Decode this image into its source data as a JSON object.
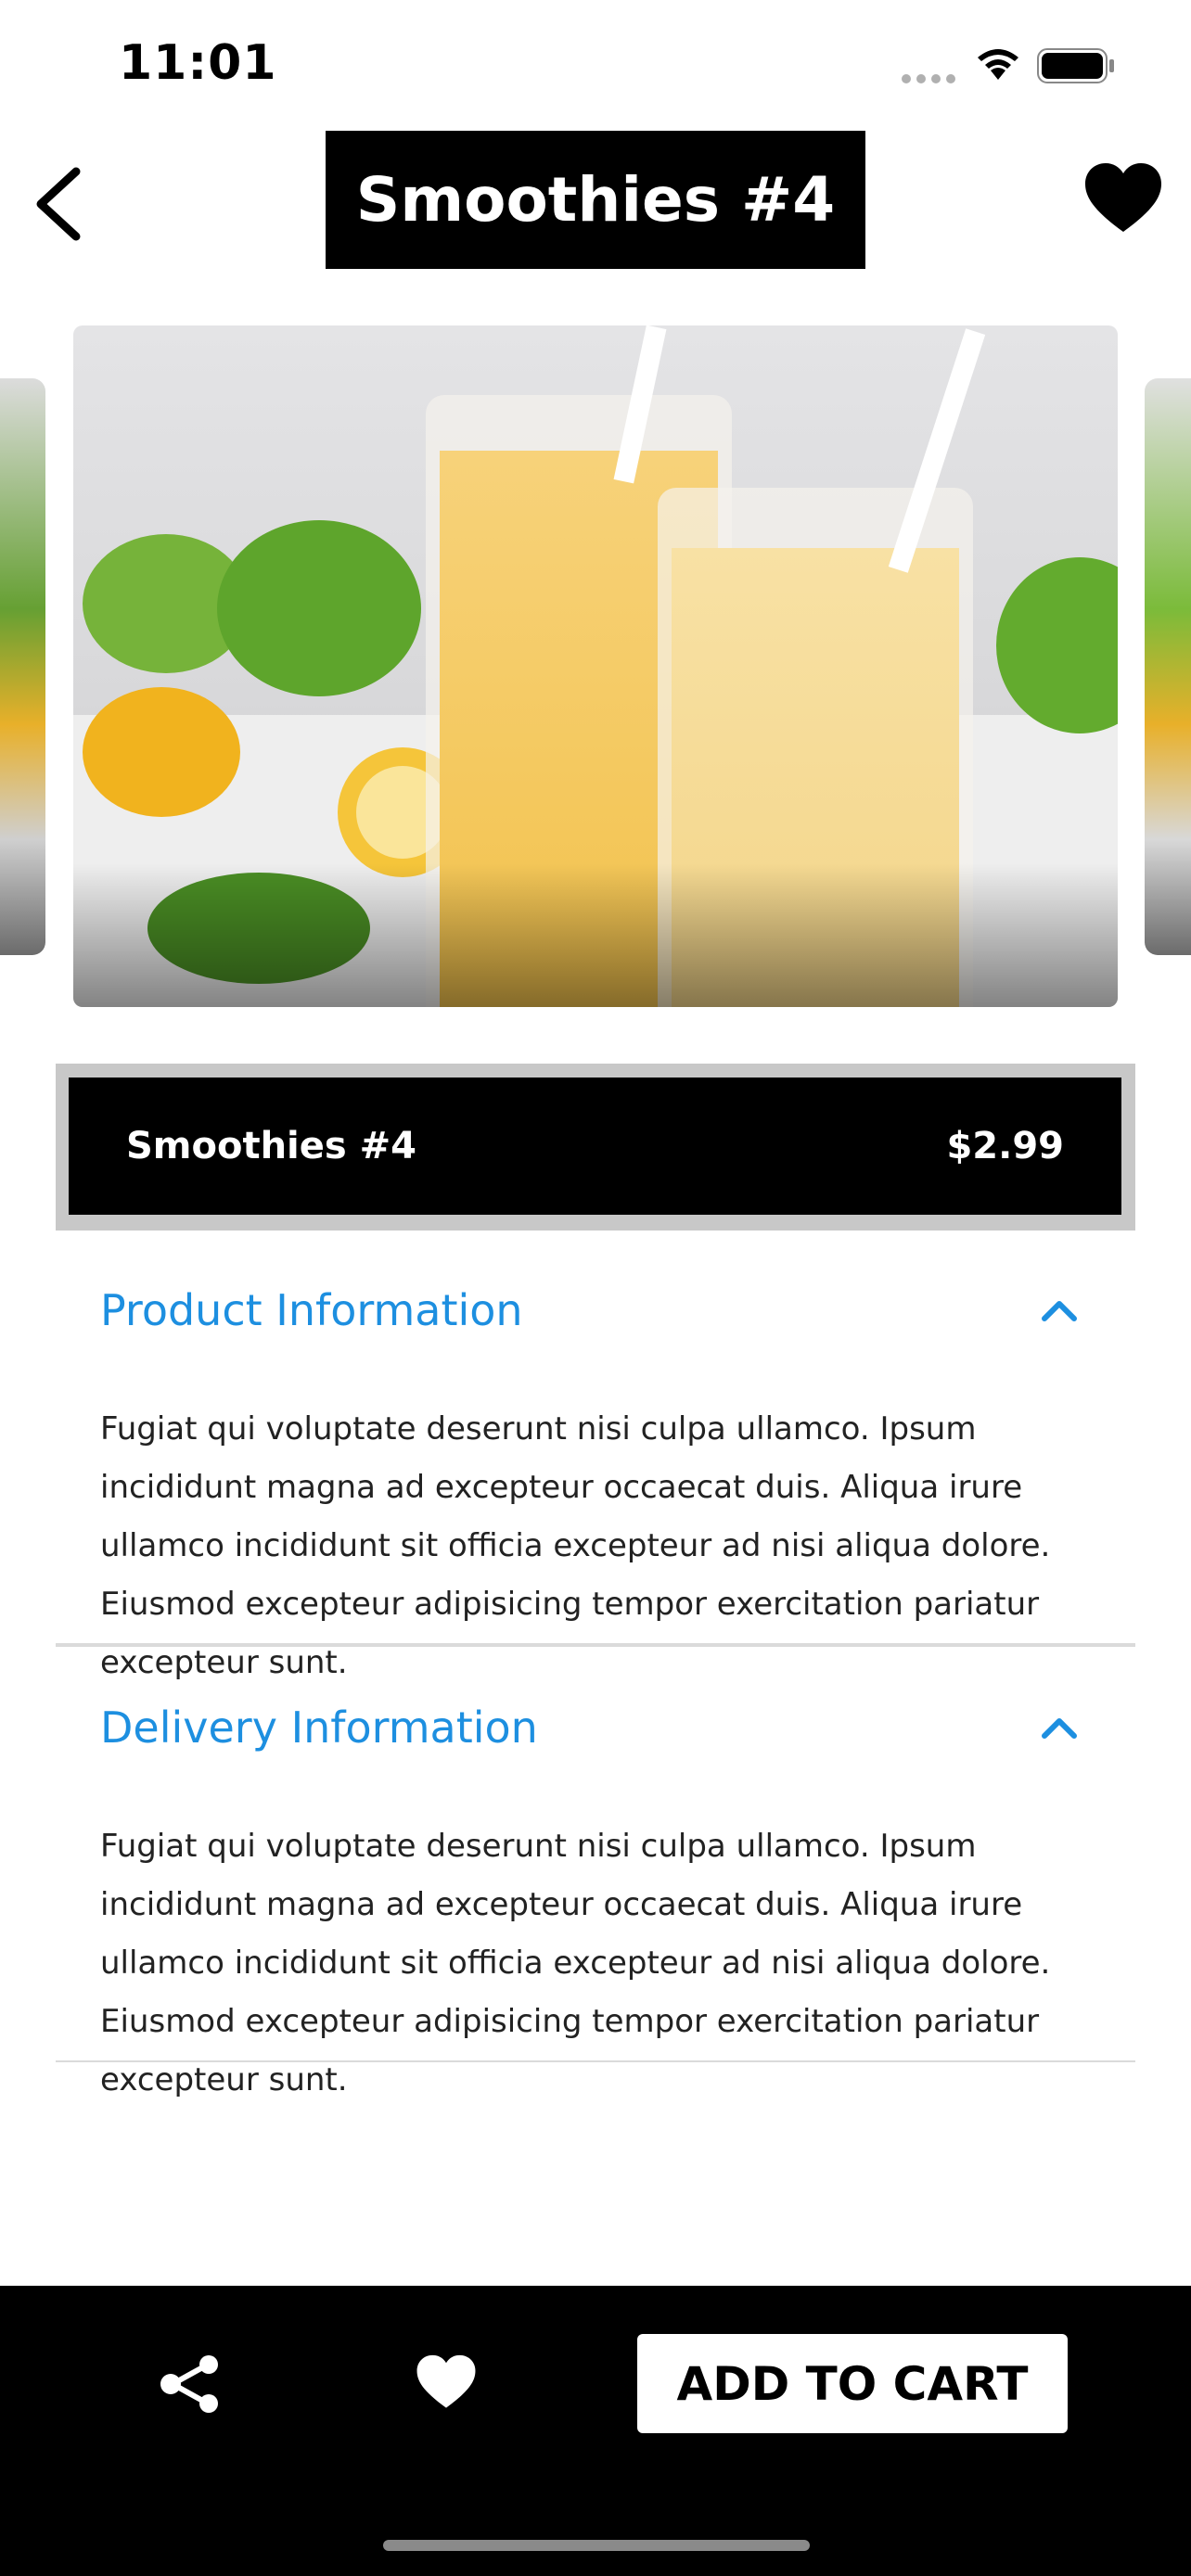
{
  "status_bar": {
    "time": "11:01"
  },
  "header": {
    "title": "Smoothies #4"
  },
  "product": {
    "name": "Smoothies #4",
    "price": "$2.99"
  },
  "sections": [
    {
      "title": "Product Information",
      "body": "Fugiat qui voluptate deserunt nisi culpa ullamco. Ipsum incididunt magna ad excepteur occaecat duis. Aliqua irure ullamco incididunt sit officia excepteur ad nisi aliqua dolore. Eiusmod excepteur adipisicing tempor exercitation pariatur excepteur sunt."
    },
    {
      "title": "Delivery Information",
      "body": "Fugiat qui voluptate deserunt nisi culpa ullamco. Ipsum incididunt magna ad excepteur occaecat duis. Aliqua irure ullamco incididunt sit officia excepteur ad nisi aliqua dolore. Eiusmod excepteur adipisicing tempor exercitation pariatur excepteur sunt."
    }
  ],
  "actions": {
    "add_to_cart": "ADD TO CART"
  },
  "colors": {
    "accent": "#1d8fe0",
    "bar": "#000000",
    "bar_border": "#c8c8c8"
  },
  "icons": [
    "back-arrow-icon",
    "heart-icon",
    "share-icon",
    "chevron-up-icon",
    "wifi-icon",
    "battery-icon",
    "signal-icon"
  ]
}
